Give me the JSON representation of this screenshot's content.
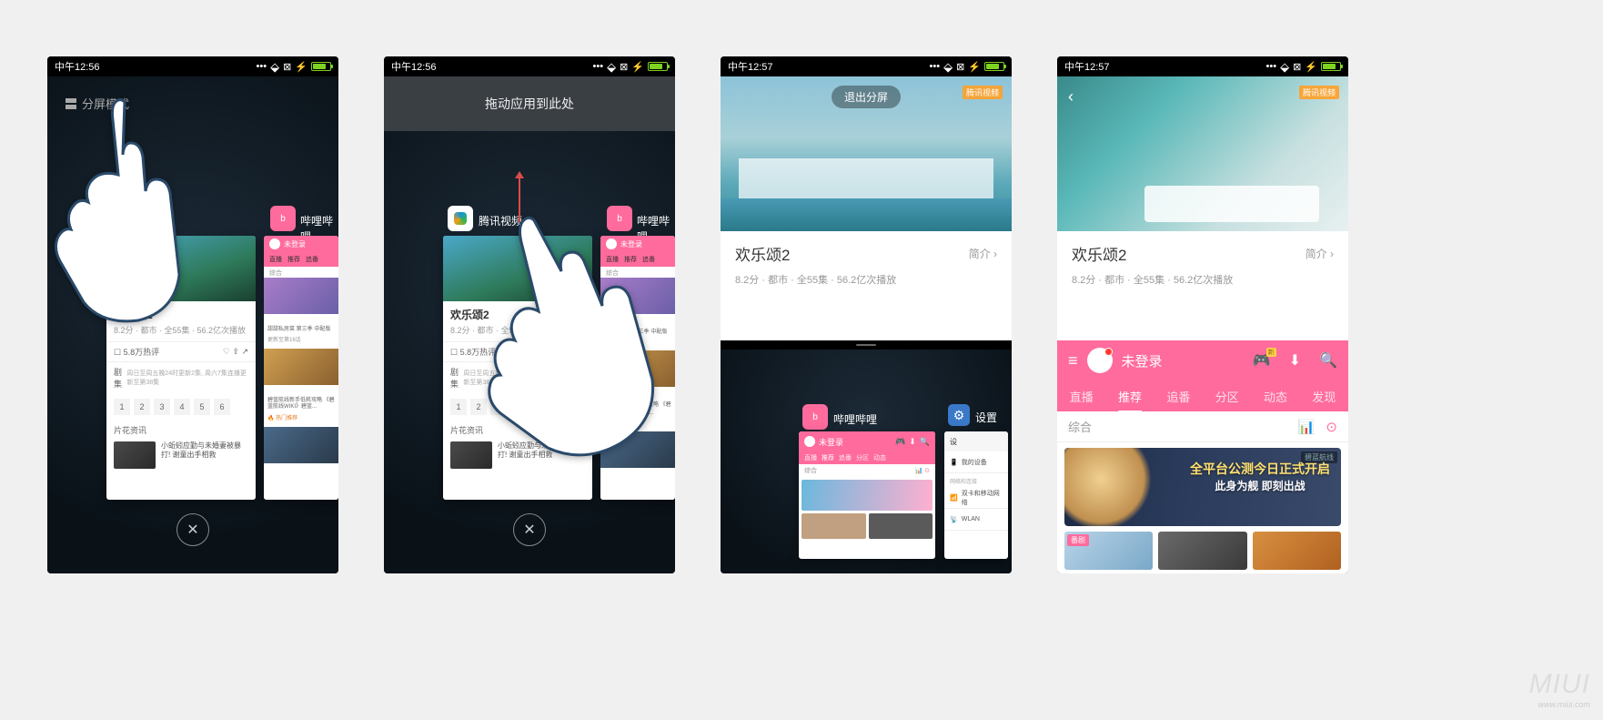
{
  "status": {
    "time1": "中午12:56",
    "time2": "中午12:57"
  },
  "p1": {
    "split_mode": "分屏模式"
  },
  "p2": {
    "drop_hint": "拖动应用到此处",
    "tx_label": "腾讯视频",
    "bi_label": "哔哩哔哩"
  },
  "recents_bi_label": "哔哩哔哩",
  "tx_preview": {
    "title": "欢乐颂2",
    "meta": "8.2分 · 都市 · 全55集 · 56.2亿次播放",
    "comments": "5.8万热评",
    "section_eps": "剧集",
    "eps_note": "周日至周五晚24时更新2集, 周六7集连播更新至第38集",
    "eps": [
      "1",
      "2",
      "3",
      "4",
      "5",
      "6"
    ],
    "clips": "片花资讯",
    "news1": "小蚯蚓应勤与未婚妻被暴打! 谢童出手相救"
  },
  "bi_preview": {
    "login": "未登录",
    "tabs": [
      "直播",
      "推荐",
      "追番",
      "分区",
      "动态"
    ],
    "sub": "综合",
    "newest": "更新至第16话",
    "line1": "甜甜私房菜 第三季 中配版",
    "line2": "碧蓝航线新手低耗攻略 《碧蓝航线WIKI》碧蓝...",
    "hot": "热门推荐"
  },
  "p3": {
    "exit_split": "退出分屏",
    "watermark": "腾讯视频",
    "title": "欢乐颂2",
    "intro": "简介",
    "meta": "8.2分 · 都市 · 全55集 · 56.2亿次播放",
    "bi_label": "哔哩哔哩",
    "set_label": "设置",
    "set_header": "设",
    "set_item1": "我的设备",
    "set_group": "网络和连接",
    "set_item2": "双卡和移动网络",
    "set_item3": "WLAN"
  },
  "p4": {
    "title": "欢乐颂2",
    "intro": "简介",
    "meta": "8.2分 · 都市 · 全55集 · 56.2亿次播放",
    "login": "未登录",
    "tabs": [
      "直播",
      "推荐",
      "追番",
      "分区",
      "动态",
      "发现"
    ],
    "sub": "综合",
    "banner_l1": "全平台公测今日正式开启",
    "banner_l2": "此身为舰 即刻出战",
    "banner_logo": "碧蓝航线",
    "tile_tag": "番剧"
  },
  "watermark": {
    "main": "MIUI",
    "sub": "www.miui.com"
  }
}
